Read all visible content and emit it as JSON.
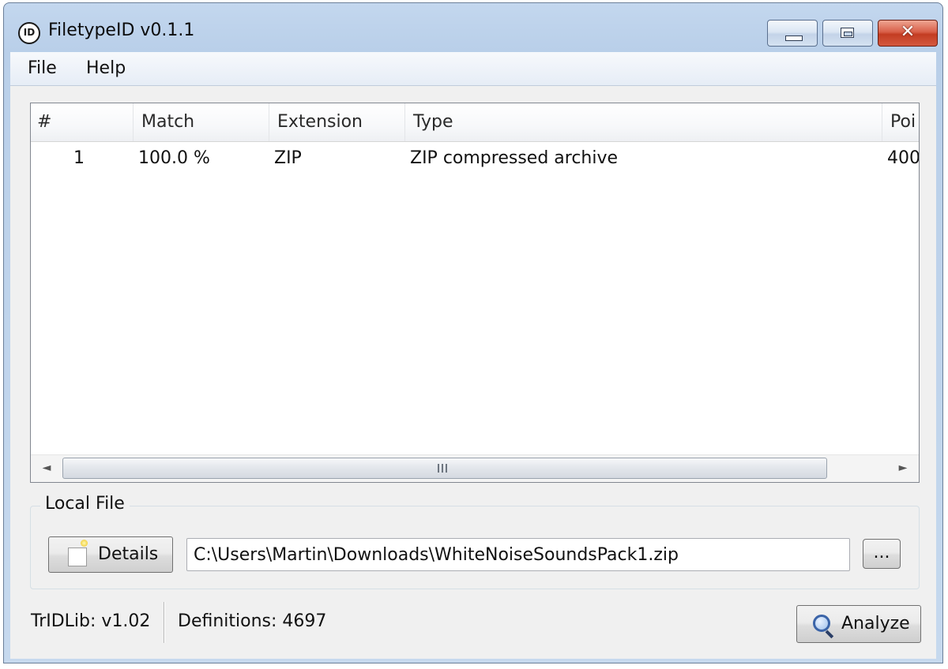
{
  "window": {
    "title": "FiletypeID v0.1.1",
    "icon_text": "ID"
  },
  "window_controls": {
    "minimize": "minimize",
    "maximize": "maximize",
    "close": "✕"
  },
  "menu": {
    "file": "File",
    "help": "Help"
  },
  "results_table": {
    "columns": [
      "#",
      "Match",
      "Extension",
      "Type",
      "Poi"
    ],
    "rows": [
      {
        "num": "1",
        "match": "100.0 %",
        "extension": "ZIP",
        "type": "ZIP compressed archive",
        "points": "400"
      }
    ]
  },
  "scrollbar": {
    "left_arrow": "◄",
    "right_arrow": "►"
  },
  "local_file": {
    "group_label": "Local File",
    "details_label": "Details",
    "path_value": "C:\\Users\\Martin\\Downloads\\WhiteNoiseSoundsPack1.zip",
    "browse_label": "..."
  },
  "status": {
    "tridlib": "TrIDLib:  v1.02",
    "definitions": "Definitions:  4697",
    "analyze_label": "Analyze"
  },
  "colors": {
    "title_bar": "#b9cfe9",
    "close_button": "#c33c22",
    "client_bg": "#f0f0f0"
  },
  "icons": [
    "filetypeid-logo-icon",
    "details-note-icon",
    "magnifier-icon"
  ]
}
